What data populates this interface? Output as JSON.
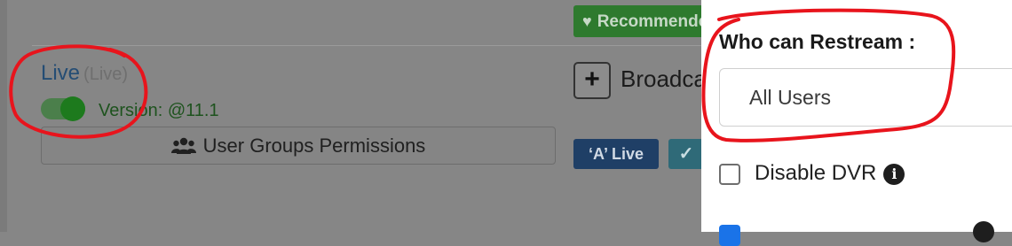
{
  "recommend_badge": {
    "label": "Recommended"
  },
  "live_item": {
    "title": "Live",
    "subtitle": "(Live)",
    "toggle_on": true,
    "version": "Version: @11.1",
    "permissions_button": "User Groups Permissions"
  },
  "broadcast": {
    "add_label": "+",
    "label": "Broadcast"
  },
  "badges": {
    "live": "‘A’ Live",
    "check": "✓"
  },
  "panel": {
    "restream_label": "Who can Restream :",
    "restream_value": "All Users",
    "disable_dvr_label": "Disable DVR",
    "disable_dvr_checked": false,
    "info_glyph": "i",
    "second_option_checked": true
  },
  "annotation_color": "#e8141c",
  "colors": {
    "recommend_green": "#2e7a2e",
    "live_badge_blue": "#1f3f66",
    "checkbox_blue": "#1a73e8"
  }
}
